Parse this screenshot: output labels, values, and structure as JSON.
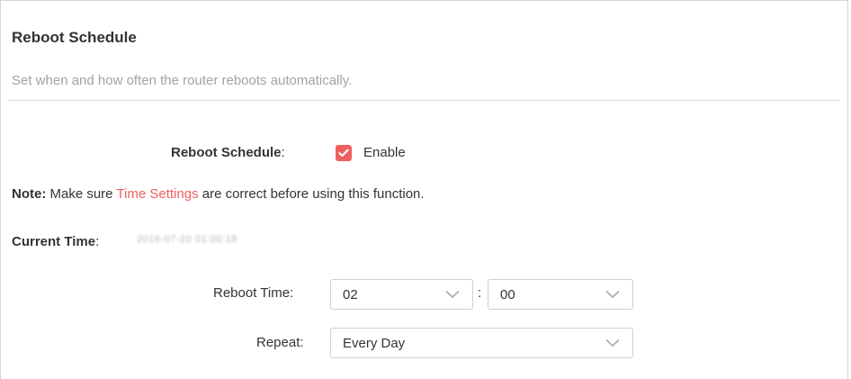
{
  "section": {
    "title": "Reboot Schedule",
    "subtitle": "Set when and how often the router reboots automatically."
  },
  "reboot_schedule": {
    "label": "Reboot Schedule",
    "colon": ":",
    "checkbox_checked": true,
    "checkbox_color": "#f05f5f",
    "enable_label": "Enable"
  },
  "note": {
    "prefix": "Note:",
    "text_before": " Make sure ",
    "link": "Time Settings",
    "text_after": " are correct before using this function."
  },
  "current_time": {
    "label": "Current Time",
    "colon": ":",
    "value": "2016-07-20 01:00:18"
  },
  "reboot_time": {
    "label": "Reboot Time:",
    "hour": "02",
    "separator": ":",
    "minute": "00"
  },
  "repeat": {
    "label": "Repeat:",
    "value": "Every Day"
  },
  "icons": {
    "checkbox": "check-icon",
    "dropdown": "chevron-down-icon"
  }
}
